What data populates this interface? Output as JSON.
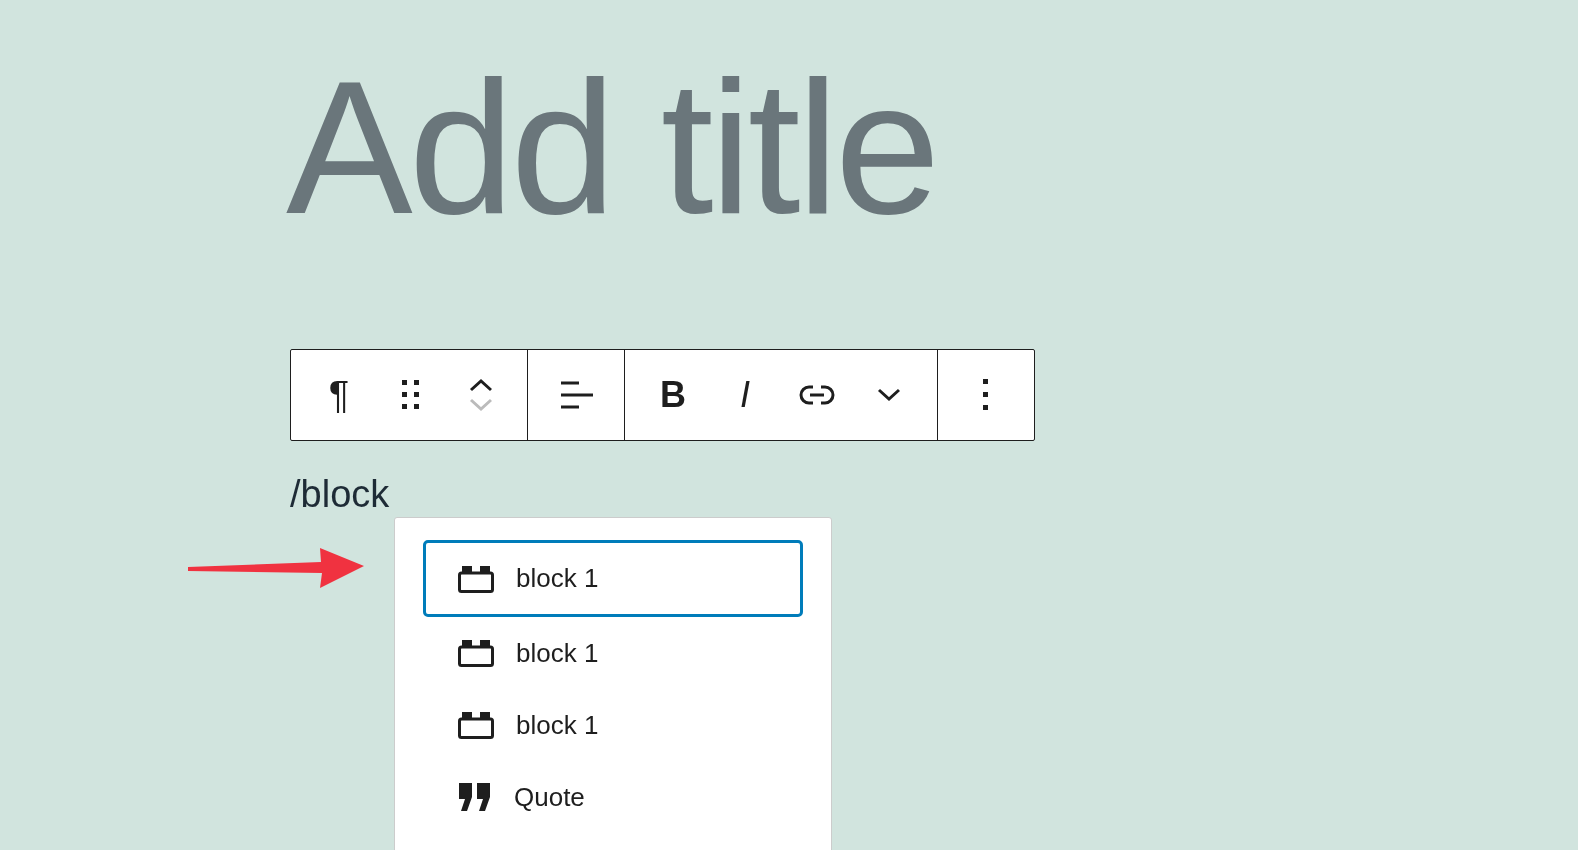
{
  "title": {
    "placeholder": "Add title"
  },
  "toolbar": {
    "groups": [
      [
        {
          "kind": "text",
          "label": "¶"
        },
        {
          "kind": "drag"
        },
        {
          "kind": "mover",
          "up_disabled": false,
          "down_disabled": true
        }
      ],
      [
        {
          "kind": "align"
        }
      ],
      [
        {
          "kind": "bold",
          "label": "B"
        },
        {
          "kind": "italic",
          "label": "I"
        },
        {
          "kind": "link"
        },
        {
          "kind": "chevron"
        }
      ],
      [
        {
          "kind": "more"
        }
      ]
    ]
  },
  "paragraph": {
    "value": "/block"
  },
  "suggestions": [
    {
      "kind": "block",
      "label": "block 1",
      "selected": true
    },
    {
      "kind": "block",
      "label": "block 1",
      "selected": false
    },
    {
      "kind": "block",
      "label": "block 1",
      "selected": false
    },
    {
      "kind": "quote",
      "label": "Quote",
      "selected": false
    }
  ]
}
